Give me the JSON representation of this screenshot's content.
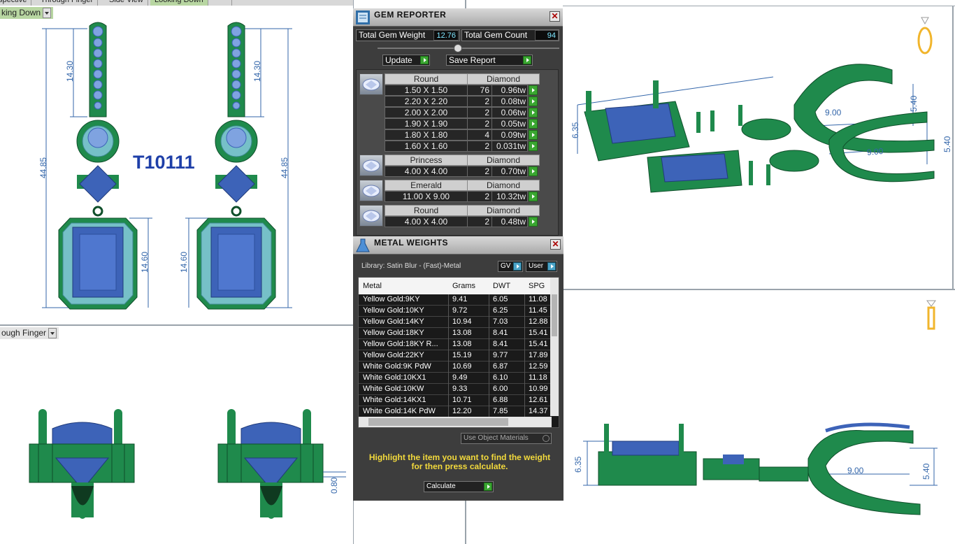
{
  "viewport_tabs": {
    "tabs": [
      "spective",
      "Through Finger",
      "Side View",
      "Looking Down"
    ],
    "active": "Looking Down"
  },
  "viewports": {
    "top_left_label": "king Down",
    "bottom_left_label": "ough Finger"
  },
  "drawing": {
    "model_name": "T10111",
    "dimensions_front": [
      "14.30",
      "44.85",
      "14.60",
      "14.30",
      "44.85",
      "14.60"
    ],
    "dimensions_side": [
      "6.35",
      "5.40",
      "9.00",
      "5.40",
      "9.00",
      "6.35",
      "0.80"
    ]
  },
  "gem_reporter": {
    "title": "GEM REPORTER",
    "total_weight_label": "Total Gem Weight",
    "total_weight_value": "12.76",
    "total_count_label": "Total Gem Count",
    "total_count_value": "94",
    "update_label": "Update",
    "save_label": "Save Report",
    "groups": [
      {
        "shape": "Round",
        "material": "Diamond",
        "icon": "round-gem-icon",
        "rows": [
          {
            "size": "1.50 X 1.50",
            "count": "76",
            "weight": "0.96tw"
          },
          {
            "size": "2.20 X 2.20",
            "count": "2",
            "weight": "0.08tw"
          },
          {
            "size": "2.00 X 2.00",
            "count": "2",
            "weight": "0.06tw"
          },
          {
            "size": "1.90 X 1.90",
            "count": "2",
            "weight": "0.05tw"
          },
          {
            "size": "1.80 X 1.80",
            "count": "4",
            "weight": "0.09tw"
          },
          {
            "size": "1.60 X 1.60",
            "count": "2",
            "weight": "0.031tw"
          }
        ]
      },
      {
        "shape": "Princess",
        "material": "Diamond",
        "icon": "princess-gem-icon",
        "rows": [
          {
            "size": "4.00 X 4.00",
            "count": "2",
            "weight": "0.70tw"
          }
        ]
      },
      {
        "shape": "Emerald",
        "material": "Diamond",
        "icon": "emerald-gem-icon",
        "rows": [
          {
            "size": "11.00 X 9.00",
            "count": "2",
            "weight": "10.32tw"
          }
        ]
      },
      {
        "shape": "Round",
        "material": "Diamond",
        "icon": "round-gem-icon",
        "rows": [
          {
            "size": "4.00 X 4.00",
            "count": "2",
            "weight": "0.48tw"
          }
        ]
      }
    ]
  },
  "metal_weights": {
    "title": "METAL WEIGHTS",
    "library": "Library: Satin Blur - (Fast)-Metal",
    "gv_label": "GV",
    "user_label": "User",
    "columns": [
      "Metal",
      "Grams",
      "DWT",
      "SPG"
    ],
    "rows": [
      [
        "Yellow Gold:9KY",
        "9.41",
        "6.05",
        "11.08"
      ],
      [
        "Yellow Gold:10KY",
        "9.72",
        "6.25",
        "11.45"
      ],
      [
        "Yellow Gold:14KY",
        "10.94",
        "7.03",
        "12.88"
      ],
      [
        "Yellow Gold:18KY",
        "13.08",
        "8.41",
        "15.41"
      ],
      [
        "Yellow Gold:18KY R...",
        "13.08",
        "8.41",
        "15.41"
      ],
      [
        "Yellow Gold:22KY",
        "15.19",
        "9.77",
        "17.89"
      ],
      [
        "White Gold:9K PdW",
        "10.69",
        "6.87",
        "12.59"
      ],
      [
        "White Gold:10KX1",
        "9.49",
        "6.10",
        "11.18"
      ],
      [
        "White Gold:10KW",
        "9.33",
        "6.00",
        "10.99"
      ],
      [
        "White Gold:14KX1",
        "10.71",
        "6.88",
        "12.61"
      ],
      [
        "White Gold:14K PdW",
        "12.20",
        "7.85",
        "14.37"
      ]
    ],
    "use_object_materials": "Use Object Materials",
    "hint": "Highlight the item you want to find the weight for then press calculate.",
    "calculate_label": "Calculate"
  },
  "colors": {
    "metal_green": "#1f8a4c",
    "gem_blue": "#3d63b8",
    "dimension_blue": "#3366aa",
    "panel_bg": "#3d3d3d",
    "hint_yellow": "#f2d93c",
    "accent_green_button": "#3aa631"
  }
}
